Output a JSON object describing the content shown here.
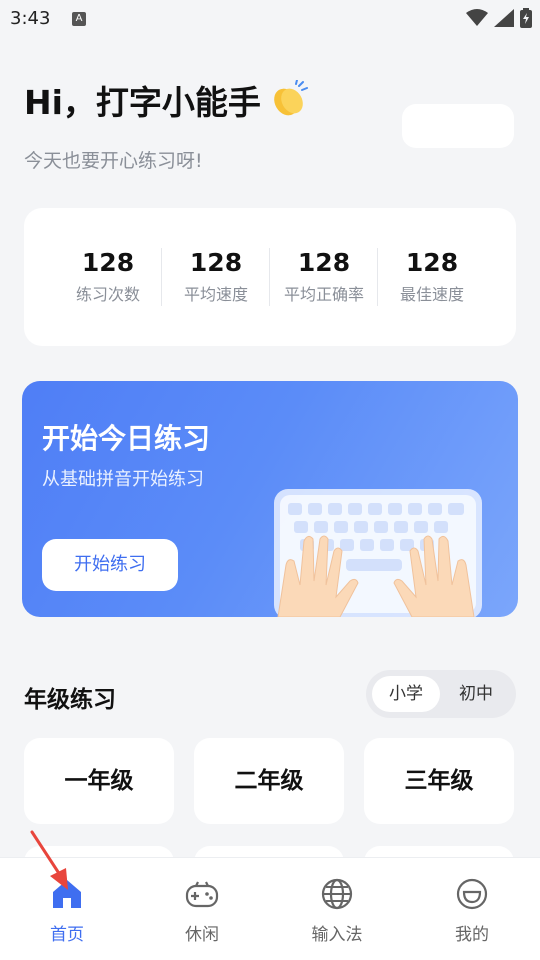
{
  "status": {
    "time": "3:43",
    "badge": "A"
  },
  "header": {
    "greeting": "Hi，打字小能手",
    "subtitle": "今天也要开心练习呀!"
  },
  "stats": [
    {
      "value": "128",
      "label": "练习次数"
    },
    {
      "value": "128",
      "label": "平均速度"
    },
    {
      "value": "128",
      "label": "平均正确率"
    },
    {
      "value": "128",
      "label": "最佳速度"
    }
  ],
  "hero": {
    "title": "开始今日练习",
    "subtitle": "从基础拼音开始练习",
    "button": "开始练习"
  },
  "grades": {
    "title": "年级练习",
    "toggle": {
      "primary": "小学",
      "middle": "初中",
      "selected": "小学"
    },
    "items": [
      "一年级",
      "二年级",
      "三年级"
    ]
  },
  "nav": {
    "items": [
      {
        "label": "首页",
        "icon": "home-icon",
        "active": true
      },
      {
        "label": "休闲",
        "icon": "gamepad-icon",
        "active": false
      },
      {
        "label": "输入法",
        "icon": "globe-icon",
        "active": false
      },
      {
        "label": "我的",
        "icon": "smile-icon",
        "active": false
      }
    ]
  },
  "colors": {
    "accent": "#3f6ef0",
    "hero_start": "#4f7ef6",
    "hero_end": "#7ba6fb",
    "background": "#f4f5f7"
  }
}
